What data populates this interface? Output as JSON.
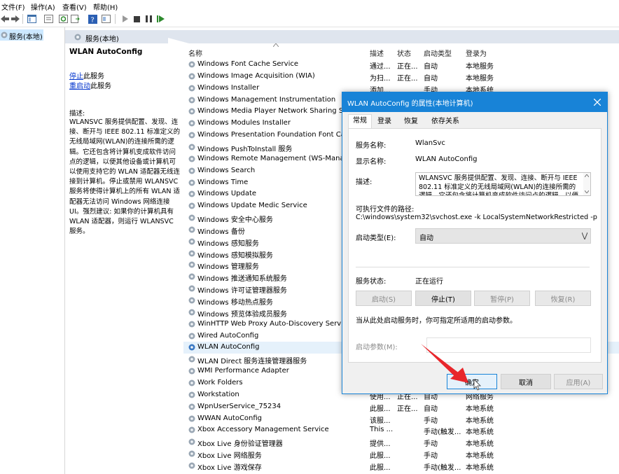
{
  "menu": [
    "文件(F)",
    "操作(A)",
    "查看(V)",
    "帮助(H)"
  ],
  "tree": {
    "root": "服务(本地)"
  },
  "main_header": {
    "title": "服务(本地)"
  },
  "desc_pane": {
    "title": "WLAN AutoConfig",
    "stop_link": "停止",
    "stop_suffix": "此服务",
    "restart_link": "重启动",
    "restart_suffix": "此服务",
    "desc_label": "描述:",
    "desc_text": "WLANSVC 服务提供配置、发现、连接、断开与 IEEE 802.11 标准定义的无线局域网(WLAN)的连接所需的逻辑。它还包含将计算机变成软件访问点的逻辑，以便其他设备或计算机可以使用支持它的 WLAN 适配器无线连接到计算机。停止或禁用 WLANSVC 服务将使得计算机上的所有 WLAN 适配器无法访问 Windows 网络连接 UI。强烈建议: 如果你的计算机具有 WLAN 适配器，则运行 WLANSVC 服务。"
  },
  "list": {
    "columns": [
      "名称",
      "描述",
      "状态",
      "启动类型",
      "登录为"
    ],
    "rows": [
      [
        "Windows Font Cache Service",
        "通过...",
        "正在...",
        "自动",
        "本地服务"
      ],
      [
        "Windows Image Acquisition (WIA)",
        "为扫...",
        "正在...",
        "自动",
        "本地服务"
      ],
      [
        "Windows Installer",
        "添加...",
        "",
        "手动",
        "本地系统"
      ],
      [
        "Windows Management Instrumentation",
        "",
        "",
        "",
        ""
      ],
      [
        "Windows Media Player Network Sharing Service",
        "",
        "",
        "",
        ""
      ],
      [
        "Windows Modules Installer",
        "",
        "",
        "",
        ""
      ],
      [
        "Windows Presentation Foundation Font Cache 3",
        "",
        "",
        "",
        ""
      ],
      [
        "Windows PushToInstall 服务",
        "",
        "",
        "",
        ""
      ],
      [
        "Windows Remote Management (WS-Manageme",
        "",
        "",
        "",
        ""
      ],
      [
        "Windows Search",
        "",
        "",
        "",
        ""
      ],
      [
        "Windows Time",
        "",
        "",
        "",
        ""
      ],
      [
        "Windows Update",
        "",
        "",
        "",
        ""
      ],
      [
        "Windows Update Medic Service",
        "",
        "",
        "",
        ""
      ],
      [
        "Windows 安全中心服务",
        "",
        "",
        "",
        ""
      ],
      [
        "Windows 备份",
        "",
        "",
        "",
        ""
      ],
      [
        "Windows 感知服务",
        "",
        "",
        "",
        ""
      ],
      [
        "Windows 感知模拟服务",
        "",
        "",
        "",
        ""
      ],
      [
        "Windows 管理服务",
        "",
        "",
        "",
        ""
      ],
      [
        "Windows 推送通知系统服务",
        "",
        "",
        "",
        ""
      ],
      [
        "Windows 许可证管理器服务",
        "",
        "",
        "",
        ""
      ],
      [
        "Windows 移动热点服务",
        "",
        "",
        "",
        ""
      ],
      [
        "Windows 预览体验成员服务",
        "",
        "",
        "",
        ""
      ],
      [
        "WinHTTP Web Proxy Auto-Discovery Service",
        "",
        "",
        "",
        ""
      ],
      [
        "Wired AutoConfig",
        "",
        "",
        "",
        ""
      ],
      [
        "WLAN AutoConfig",
        "",
        "",
        "",
        ""
      ],
      [
        "WLAN Direct 服务连接管理器服务",
        "",
        "",
        "",
        ""
      ],
      [
        "WMI Performance Adapter",
        "",
        "",
        "",
        ""
      ],
      [
        "Work Folders",
        "",
        "",
        "",
        ""
      ],
      [
        "Workstation",
        "使用...",
        "正在...",
        "自动",
        "网络服务"
      ],
      [
        "WpnUserService_75234",
        "此服...",
        "正在...",
        "自动",
        "本地系统"
      ],
      [
        "WWAN AutoConfig",
        "该服...",
        "",
        "手动",
        "本地系统"
      ],
      [
        "Xbox Accessory Management Service",
        "This ...",
        "",
        "手动(触发...",
        "本地系统"
      ],
      [
        "Xbox Live 身份验证管理器",
        "提供...",
        "",
        "手动",
        "本地系统"
      ],
      [
        "Xbox Live 网络服务",
        "此服...",
        "",
        "手动",
        "本地系统"
      ],
      [
        "Xbox Live 游戏保存",
        "此服...",
        "",
        "手动(触发...",
        "本地系统"
      ]
    ],
    "selected_index": 24
  },
  "dialog": {
    "title": "WLAN AutoConfig 的属性(本地计算机)",
    "tabs": [
      "常规",
      "登录",
      "恢复",
      "依存关系"
    ],
    "service_name_label": "服务名称:",
    "service_name": "WlanSvc",
    "display_name_label": "显示名称:",
    "display_name": "WLAN AutoConfig",
    "description_label": "描述:",
    "description": "WLANSVC 服务提供配置、发现、连接、断开与 IEEE 802.11 标准定义的无线局域网(WLAN)的连接所需的逻辑。它还包含将计算机变成软件访问点的逻辑，以便其",
    "path_label": "可执行文件的路径:",
    "path": "C:\\windows\\system32\\svchost.exe -k LocalSystemNetworkRestricted -p",
    "startup_label": "启动类型(E):",
    "startup_value": "自动",
    "status_label": "服务状态:",
    "status_value": "正在运行",
    "btn_start": "启动(S)",
    "btn_stop": "停止(T)",
    "btn_pause": "暂停(P)",
    "btn_resume": "恢复(R)",
    "hint": "当从此处启动服务时，你可指定所适用的启动参数。",
    "param_label": "启动参数(M):",
    "ok": "确定",
    "cancel": "取消",
    "apply": "应用(A)"
  },
  "colors": {
    "accent": "#1883d7",
    "selection": "#cce8ff",
    "annotation": "#e8262b"
  }
}
